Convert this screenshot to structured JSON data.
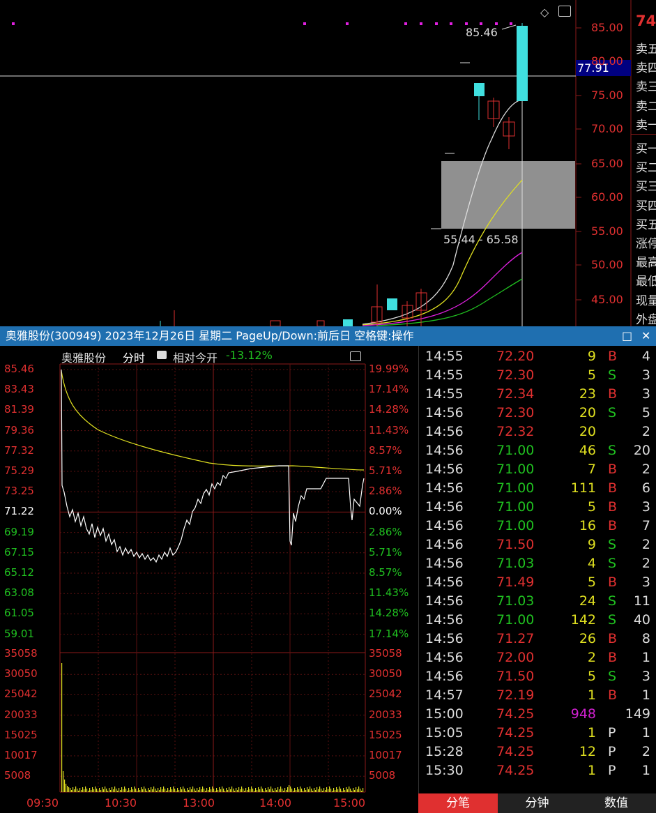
{
  "kline": {
    "price_ticks": [
      "85.00",
      "80.00",
      "75.00",
      "70.00",
      "65.00",
      "60.00",
      "55.00",
      "50.00",
      "45.00"
    ],
    "high_label": "85.46",
    "crosshair_price": "77.91",
    "range_label": "55.44 - 65.58",
    "side_price": "74",
    "side_labels": [
      "卖五",
      "卖四",
      "卖三",
      "卖二",
      "卖一",
      "买一",
      "买二",
      "买三",
      "买四",
      "买五",
      "涨停",
      "最高",
      "最低",
      "现量",
      "外盘"
    ]
  },
  "titlebar": {
    "text": "奥雅股份(300949) 2023年12月26日 星期二 PageUp/Down:前后日 空格键:操作",
    "restore_icon": "□",
    "close_icon": "✕"
  },
  "intraday": {
    "name": "奥雅股份",
    "mode": "分时",
    "relative_label": "相对今开",
    "relative_value": "-13.12%",
    "price_ticks": [
      "85.46",
      "83.43",
      "81.39",
      "79.36",
      "77.32",
      "75.29",
      "73.25",
      "71.22",
      "69.19",
      "67.15",
      "65.12",
      "63.08",
      "61.05",
      "59.01"
    ],
    "pct_ticks": [
      "19.99%",
      "17.14%",
      "14.28%",
      "11.43%",
      "8.57%",
      "5.71%",
      "2.86%",
      "0.00%",
      "2.86%",
      "5.71%",
      "8.57%",
      "11.43%",
      "14.28%",
      "17.14%"
    ],
    "volume_ticks": [
      "35058",
      "30050",
      "25042",
      "20033",
      "15025",
      "10017",
      "5008"
    ],
    "time_ticks": [
      "09:30",
      "10:30",
      "13:00",
      "14:00",
      "15:00"
    ],
    "colors": {
      "up": "#e03030",
      "down": "#20c020",
      "flat": "#ffffff",
      "avg": "#e0e020"
    }
  },
  "trades": [
    {
      "time": "14:55",
      "price": "72.20",
      "pc": "up",
      "vol": "9",
      "side": "B",
      "n": "4"
    },
    {
      "time": "14:55",
      "price": "72.30",
      "pc": "up",
      "vol": "5",
      "side": "S",
      "n": "3"
    },
    {
      "time": "14:55",
      "price": "72.34",
      "pc": "up",
      "vol": "23",
      "side": "B",
      "n": "3"
    },
    {
      "time": "14:56",
      "price": "72.30",
      "pc": "up",
      "vol": "20",
      "side": "S",
      "n": "5"
    },
    {
      "time": "14:56",
      "price": "72.32",
      "pc": "up",
      "vol": "20",
      "side": "",
      "n": "2"
    },
    {
      "time": "14:56",
      "price": "71.00",
      "pc": "down",
      "vol": "46",
      "side": "S",
      "n": "20"
    },
    {
      "time": "14:56",
      "price": "71.00",
      "pc": "down",
      "vol": "7",
      "side": "B",
      "n": "2"
    },
    {
      "time": "14:56",
      "price": "71.00",
      "pc": "down",
      "vol": "111",
      "side": "B",
      "n": "6"
    },
    {
      "time": "14:56",
      "price": "71.00",
      "pc": "down",
      "vol": "5",
      "side": "B",
      "n": "3"
    },
    {
      "time": "14:56",
      "price": "71.00",
      "pc": "down",
      "vol": "16",
      "side": "B",
      "n": "7"
    },
    {
      "time": "14:56",
      "price": "71.50",
      "pc": "up",
      "vol": "9",
      "side": "S",
      "n": "2"
    },
    {
      "time": "14:56",
      "price": "71.03",
      "pc": "down",
      "vol": "4",
      "side": "S",
      "n": "2"
    },
    {
      "time": "14:56",
      "price": "71.49",
      "pc": "up",
      "vol": "5",
      "side": "B",
      "n": "3"
    },
    {
      "time": "14:56",
      "price": "71.03",
      "pc": "down",
      "vol": "24",
      "side": "S",
      "n": "11"
    },
    {
      "time": "14:56",
      "price": "71.00",
      "pc": "down",
      "vol": "142",
      "side": "S",
      "n": "40"
    },
    {
      "time": "14:56",
      "price": "71.27",
      "pc": "up",
      "vol": "26",
      "side": "B",
      "n": "8"
    },
    {
      "time": "14:56",
      "price": "72.00",
      "pc": "up",
      "vol": "2",
      "side": "B",
      "n": "1"
    },
    {
      "time": "14:56",
      "price": "71.50",
      "pc": "up",
      "vol": "5",
      "side": "S",
      "n": "3"
    },
    {
      "time": "14:57",
      "price": "72.19",
      "pc": "up",
      "vol": "1",
      "side": "B",
      "n": "1"
    },
    {
      "time": "15:00",
      "price": "74.25",
      "pc": "up",
      "vol": "948",
      "side": "",
      "n": "149",
      "big": true
    },
    {
      "time": "15:05",
      "price": "74.25",
      "pc": "up",
      "vol": "1",
      "side": "P",
      "n": "1"
    },
    {
      "time": "15:28",
      "price": "74.25",
      "pc": "up",
      "vol": "12",
      "side": "P",
      "n": "2"
    },
    {
      "time": "15:30",
      "price": "74.25",
      "pc": "up",
      "vol": "1",
      "side": "P",
      "n": "1"
    }
  ],
  "tabs": [
    "分笔",
    "分钟",
    "数值"
  ]
}
